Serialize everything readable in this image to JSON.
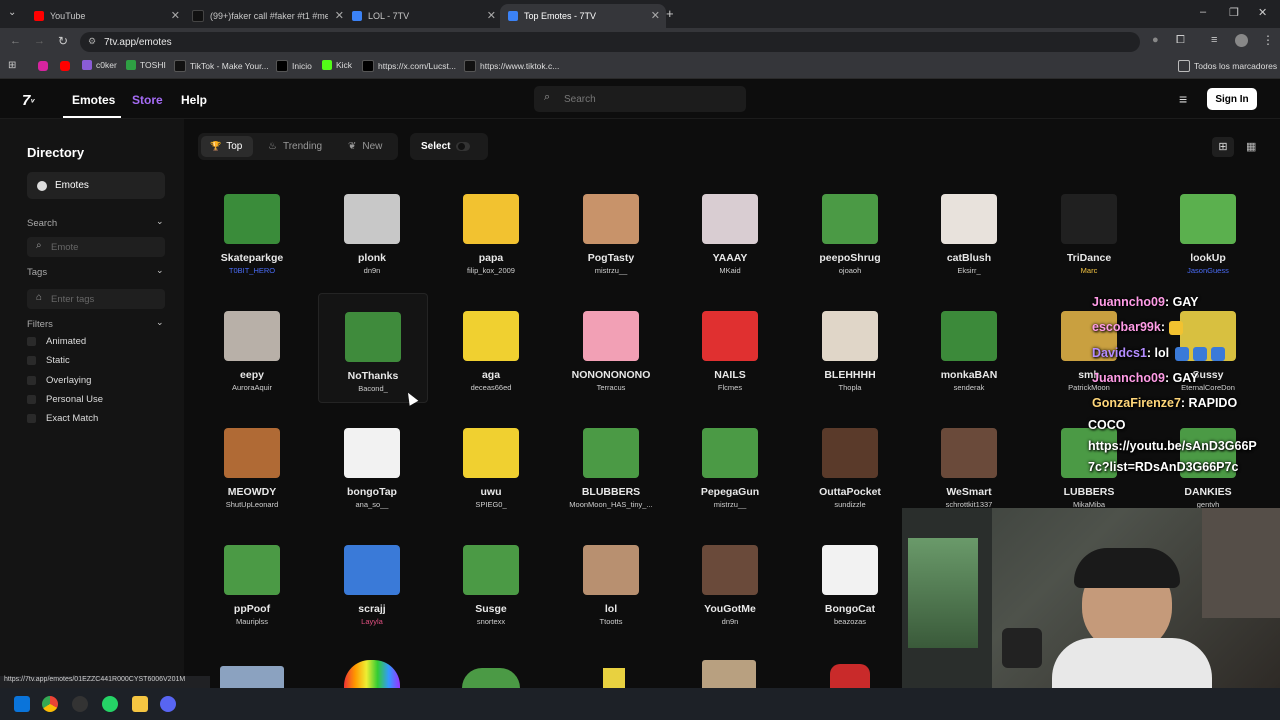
{
  "browser": {
    "tabs": [
      {
        "title": "YouTube",
        "color": "#ff0000"
      },
      {
        "title": "(99+)faker call #faker #t1 #me",
        "color": "#111111"
      },
      {
        "title": "LOL - 7TV",
        "color": "#3b82f6"
      },
      {
        "title": "Top Emotes - 7TV",
        "color": "#3b82f6"
      }
    ],
    "url": "7tv.app/emotes",
    "bookmarks": [
      "c0ker",
      "TOSHI",
      "TikTok - Make Your...",
      "Inicio",
      "Kick",
      "https://x.com/Lucst...",
      "https://www.tiktok.c..."
    ],
    "all_bookmarks": "Todos los marcadores",
    "status_url": "https://7tv.app/emotes/01EZZC441R000CYST6006V201M"
  },
  "site": {
    "logo": "7TV logo",
    "nav": [
      "Emotes",
      "Store",
      "Help"
    ],
    "search_placeholder": "Search",
    "signin_label": "Sign In"
  },
  "sidebar": {
    "title": "Directory",
    "emotes_label": "Emotes",
    "search_label": "Search",
    "search_placeholder": "Emote",
    "tags_label": "Tags",
    "tags_placeholder": "Enter tags",
    "filters_label": "Filters",
    "filters": [
      "Animated",
      "Static",
      "Overlaying",
      "Personal Use",
      "Exact Match"
    ]
  },
  "filterbar": {
    "top": "Top",
    "trending": "Trending",
    "new": "New",
    "select": "Select"
  },
  "emotes": [
    {
      "name": "Skateparkge",
      "author": "T0BIT_HERO",
      "color": "#3a8c3a",
      "author_color": "#4a6cf7"
    },
    {
      "name": "plonk",
      "author": "dn9n",
      "color": "#c8c8c8",
      "author_color": "#cfcfcf"
    },
    {
      "name": "papa",
      "author": "filip_kox_2009",
      "color": "#f2c230",
      "author_color": "#cfcfcf"
    },
    {
      "name": "PogTasty",
      "author": "mistrzu__",
      "color": "#c8936a",
      "author_color": "#cfcfcf"
    },
    {
      "name": "YAAAY",
      "author": "MKaid",
      "color": "#d9cdd2",
      "author_color": "#cfcfcf"
    },
    {
      "name": "peepoShrug",
      "author": "ojoaoh",
      "color": "#4b9a45",
      "author_color": "#cfcfcf"
    },
    {
      "name": "catBlush",
      "author": "Eksirr_",
      "color": "#e8e2dc",
      "author_color": "#cfcfcf"
    },
    {
      "name": "TriDance",
      "author": "Marc",
      "color": "#202020",
      "author_color": "#f5c542"
    },
    {
      "name": "lookUp",
      "author": "JasonGuess",
      "color": "#5bb04e",
      "author_color": "#4a6cf7"
    },
    {
      "name": "eepy",
      "author": "AuroraAquir",
      "color": "#b8b0a8",
      "author_color": "#cfcfcf"
    },
    {
      "name": "NoThanks",
      "author": "Bacond_",
      "color": "#3f8b3c",
      "author_color": "#cfcfcf"
    },
    {
      "name": "aga",
      "author": "deceas66ed",
      "color": "#f0d030",
      "author_color": "#cfcfcf"
    },
    {
      "name": "NONONONONO",
      "author": "Terracus",
      "color": "#f2a0b5",
      "author_color": "#cfcfcf"
    },
    {
      "name": "NAILS",
      "author": "Flcmes",
      "color": "#e03030",
      "author_color": "#cfcfcf"
    },
    {
      "name": "BLEHHHH",
      "author": "Thopla",
      "color": "#e0d6c8",
      "author_color": "#cfcfcf"
    },
    {
      "name": "monkaBAN",
      "author": "senderak",
      "color": "#3c8a3a",
      "author_color": "#cfcfcf"
    },
    {
      "name": "smh",
      "author": "PatrickMoon",
      "color": "#c9a040",
      "author_color": "#cfcfcf"
    },
    {
      "name": "Sussy",
      "author": "EternalCoreDon",
      "color": "#d8c040",
      "author_color": "#cfcfcf"
    },
    {
      "name": "MEOWDY",
      "author": "ShutUpLeonard",
      "color": "#b06a35",
      "author_color": "#cfcfcf"
    },
    {
      "name": "bongoTap",
      "author": "ana_so__",
      "color": "#f2f2f2",
      "author_color": "#cfcfcf"
    },
    {
      "name": "uwu",
      "author": "SPIEG0_",
      "color": "#f0d030",
      "author_color": "#cfcfcf"
    },
    {
      "name": "BLUBBERS",
      "author": "MoonMoon_HAS_tiny_...",
      "color": "#4b9a45",
      "author_color": "#cfcfcf"
    },
    {
      "name": "PepegaGun",
      "author": "mistrzu__",
      "color": "#4b9a45",
      "author_color": "#cfcfcf"
    },
    {
      "name": "OuttaPocket",
      "author": "sundizzle",
      "color": "#5a3a2a",
      "author_color": "#cfcfcf"
    },
    {
      "name": "WeSmart",
      "author": "schrottkit1337",
      "color": "#6a4a3a",
      "author_color": "#cfcfcf"
    },
    {
      "name": "LUBBERS",
      "author": "MikaMiba",
      "color": "#4b9a45",
      "author_color": "#cfcfcf"
    },
    {
      "name": "DANKIES",
      "author": "gentvh",
      "color": "#4b9a45",
      "author_color": "#cfcfcf"
    },
    {
      "name": "ppPoof",
      "author": "Mauriplss",
      "color": "#4b9a45",
      "author_color": "#cfcfcf"
    },
    {
      "name": "scrajj",
      "author": "Layyla",
      "color": "#3a7ad8",
      "author_color": "#e05080"
    },
    {
      "name": "Susge",
      "author": "snortexx",
      "color": "#4b9a45",
      "author_color": "#cfcfcf"
    },
    {
      "name": "lol",
      "author": "Ttootts",
      "color": "#b89070",
      "author_color": "#cfcfcf"
    },
    {
      "name": "YouGotMe",
      "author": "dn9n",
      "color": "#6a4a3a",
      "author_color": "#cfcfcf"
    },
    {
      "name": "BongoCat",
      "author": "beazozas",
      "color": "#f2f2f2",
      "author_color": "#cfcfcf"
    }
  ],
  "chat": [
    {
      "user": "Juanncho09",
      "text": ": GAY",
      "color": "#ffffff"
    },
    {
      "user": "escobar99k",
      "text": ":",
      "color": "#ffffff"
    },
    {
      "user": "Davidcs1",
      "text": ": lol",
      "color": "#ffffff"
    },
    {
      "user": "Juanncho09",
      "text": ": GAY",
      "color": "#ffffff"
    },
    {
      "user": "GonzaFirenze7",
      "text": ":  RAPIDO",
      "color": "#ffffff"
    },
    {
      "user": "",
      "text": "COCO",
      "color": "#ffffff"
    },
    {
      "user": "",
      "text": "https://youtu.be/sAnD3G66P",
      "color": "#ffffff"
    },
    {
      "user": "",
      "text": "7c?list=RDsAnD3G66P7c",
      "color": "#ffffff"
    }
  ]
}
